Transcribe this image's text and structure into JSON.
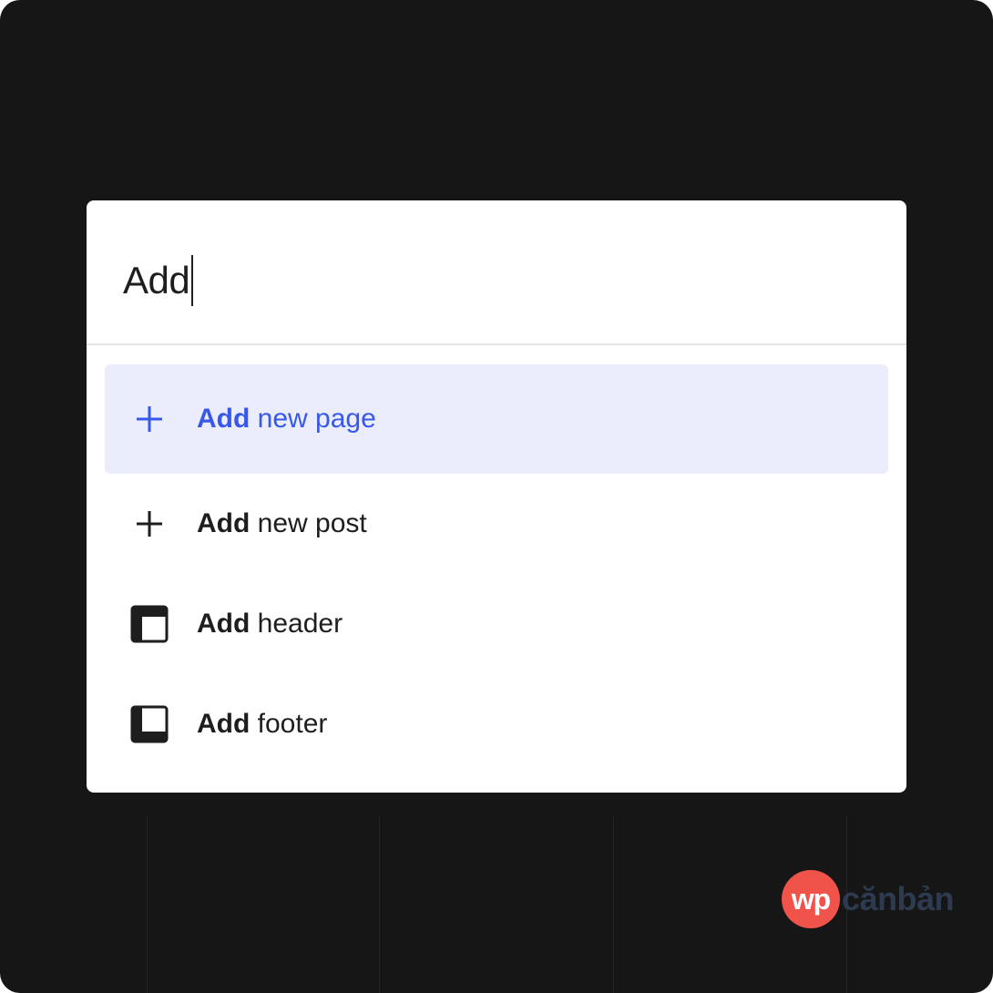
{
  "search": {
    "query": "Add"
  },
  "results": [
    {
      "icon": "plus-icon",
      "keyword": "Add",
      "rest": " new page",
      "selected": true
    },
    {
      "icon": "plus-icon",
      "keyword": "Add",
      "rest": " new post",
      "selected": false
    },
    {
      "icon": "header-layout-icon",
      "keyword": "Add",
      "rest": " header",
      "selected": false
    },
    {
      "icon": "footer-layout-icon",
      "keyword": "Add",
      "rest": " footer",
      "selected": false
    }
  ],
  "watermark": {
    "badge": "wp",
    "text": "cănbản"
  },
  "colors": {
    "accent": "#3858e9",
    "selected_bg": "#ecedfc",
    "backdrop": "#161617",
    "text": "#1e1e1e",
    "watermark_badge": "#f0534a"
  }
}
